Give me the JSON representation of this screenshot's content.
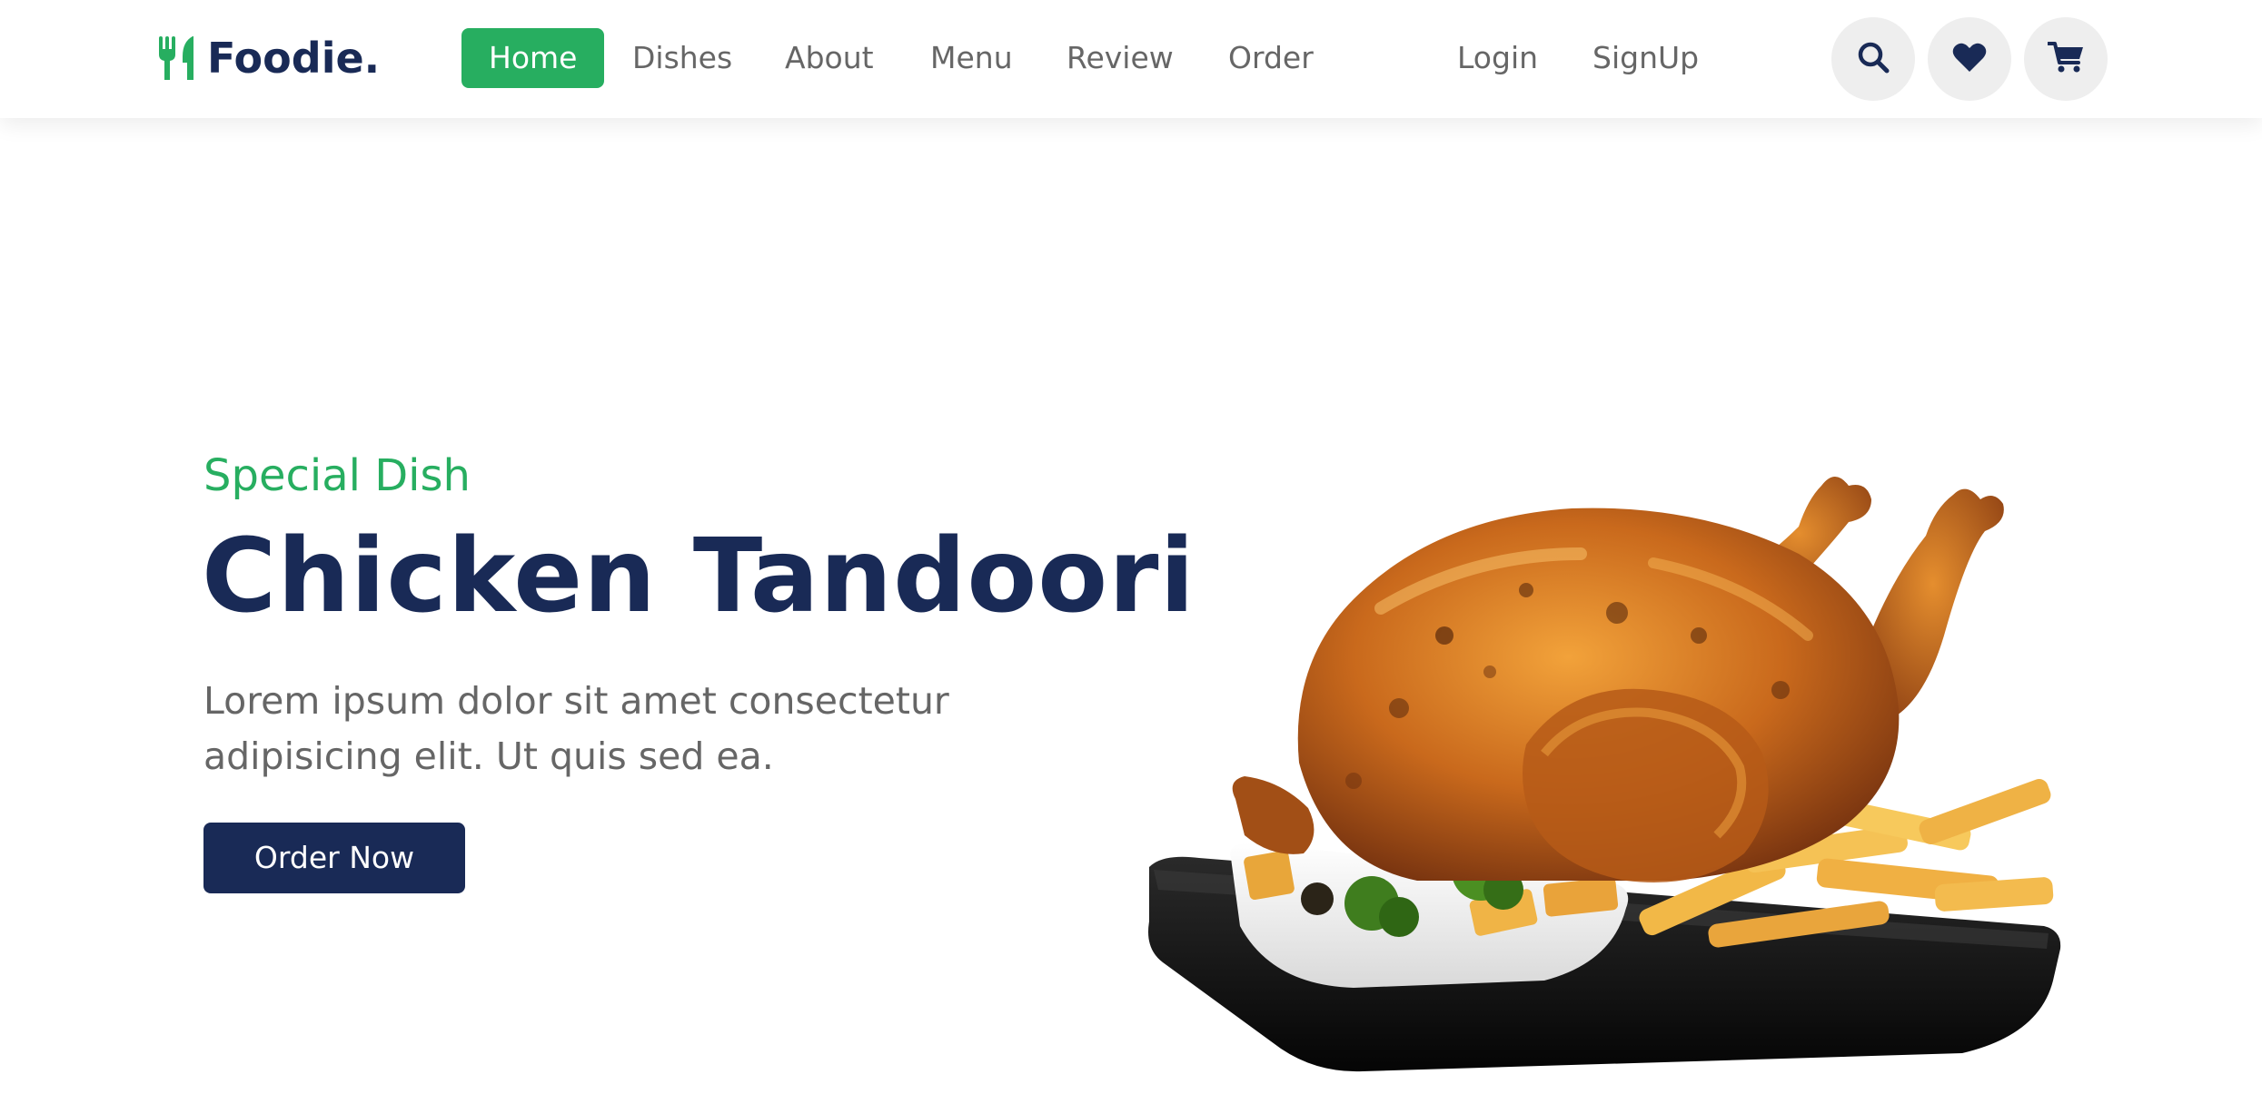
{
  "header": {
    "brand": "Foodie.",
    "nav": [
      {
        "label": "Home",
        "active": true
      },
      {
        "label": "Dishes",
        "active": false
      },
      {
        "label": "About",
        "active": false
      },
      {
        "label": "Menu",
        "active": false
      },
      {
        "label": "Review",
        "active": false
      },
      {
        "label": "Order",
        "active": false
      }
    ],
    "auth": [
      {
        "label": "Login"
      },
      {
        "label": "SignUp"
      }
    ],
    "icons": [
      "search-icon",
      "heart-icon",
      "cart-icon"
    ]
  },
  "hero": {
    "eyebrow": "Special Dish",
    "title": "Chicken Tandoori",
    "text": "Lorem ipsum dolor sit amet consectetur adipisicing elit. Ut quis sed ea.",
    "button": "Order Now"
  },
  "colors": {
    "accent": "#27ae60",
    "primary": "#192a56",
    "text": "#666666",
    "icon_bg": "#eeeeee"
  }
}
